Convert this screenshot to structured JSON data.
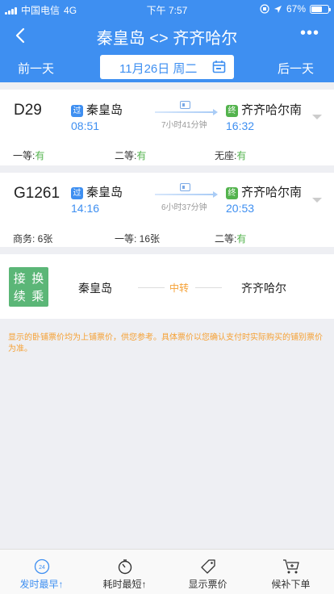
{
  "status_bar": {
    "carrier": "中国电信",
    "network": "4G",
    "time": "下午 7:57",
    "battery": "67%",
    "battery_level": 0.67
  },
  "nav": {
    "title": "秦皇岛 <> 齐齐哈尔",
    "back_icon": "chevron-left-icon",
    "more_label": "•••"
  },
  "date_bar": {
    "prev_label": "前一天",
    "date_label": "11月26日 周二",
    "next_label": "后一天"
  },
  "trains": [
    {
      "number": "D29",
      "from_badge": "过",
      "from_station": "秦皇岛",
      "depart": "08:51",
      "duration": "7小时41分钟",
      "to_badge": "终",
      "to_station": "齐齐哈尔南",
      "arrive": "16:32",
      "seats": [
        {
          "label": "一等:",
          "value": "有",
          "status": "ok"
        },
        {
          "label": "二等:",
          "value": "有",
          "status": "ok"
        },
        {
          "label": "无座:",
          "value": "有",
          "status": "ok"
        }
      ]
    },
    {
      "number": "G1261",
      "from_badge": "过",
      "from_station": "秦皇岛",
      "depart": "14:16",
      "duration": "6小时37分钟",
      "to_badge": "终",
      "to_station": "齐齐哈尔南",
      "arrive": "20:53",
      "seats": [
        {
          "label": "商务: 6张",
          "value": "",
          "status": "count"
        },
        {
          "label": "一等: 16张",
          "value": "",
          "status": "count"
        },
        {
          "label": "二等:",
          "value": "有",
          "status": "ok"
        }
      ]
    }
  ],
  "transfer": {
    "icon_chars": [
      "接",
      "换",
      "续",
      "乘"
    ],
    "from": "秦皇岛",
    "middle": "中转",
    "to": "齐齐哈尔"
  },
  "notice": "显示的卧铺票价均为上铺票价，供您参考。具体票价以您确认支付时实际购买的铺别票价为准。",
  "tabs": [
    {
      "label": "发时最早↑",
      "icon": "clock-24-icon",
      "icon_text": "24",
      "active": true
    },
    {
      "label": "耗时最短↑",
      "icon": "stopwatch-icon",
      "active": false
    },
    {
      "label": "显示票价",
      "icon": "price-tag-icon",
      "active": false
    },
    {
      "label": "候补下单",
      "icon": "cart-icon",
      "active": false
    }
  ],
  "colors": {
    "primary": "#3e8ff1",
    "available": "#53b34d",
    "warning": "#f5a033",
    "transfer_bg": "#5bb677"
  }
}
